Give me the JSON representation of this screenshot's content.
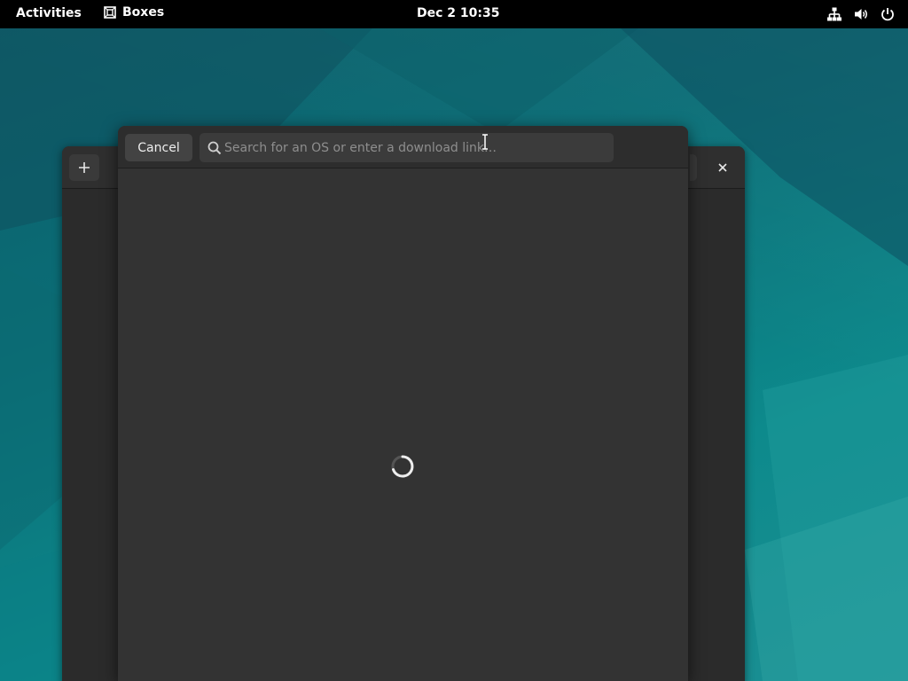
{
  "topbar": {
    "activities_label": "Activities",
    "app_name": "Boxes",
    "clock": "Dec 2  10:35",
    "tray_icons": [
      "network-icon",
      "volume-icon",
      "power-icon"
    ]
  },
  "main_window": {
    "add_icon": "plus-icon",
    "close_icon": "close-icon"
  },
  "dialog": {
    "cancel_label": "Cancel",
    "search": {
      "placeholder": "Search for an OS or enter a download link…",
      "value": ""
    },
    "loading_icon": "spinner-icon"
  },
  "colors": {
    "topbar_bg": "#000000",
    "dialog_bg": "#333333",
    "header_bg": "#2d2d2d",
    "button_bg": "#434343",
    "search_bg": "#3b3b3b"
  }
}
